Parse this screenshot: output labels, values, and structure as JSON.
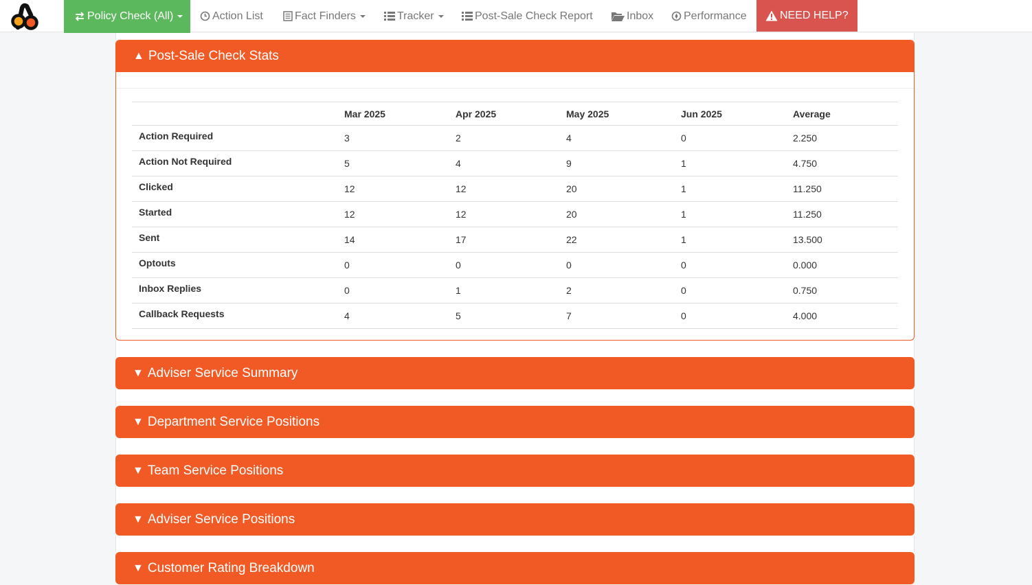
{
  "nav": {
    "items": [
      {
        "label": "Policy Check (All)",
        "icon": "exchange-arrows-icon",
        "dropdown": true
      },
      {
        "label": "Action List",
        "icon": "clock-icon",
        "dropdown": false
      },
      {
        "label": "Fact Finders",
        "icon": "document-list-icon",
        "dropdown": true
      },
      {
        "label": "Tracker",
        "icon": "list-icon",
        "dropdown": true
      },
      {
        "label": "Post-Sale Check Report",
        "icon": "list-icon",
        "dropdown": false
      },
      {
        "label": "Inbox",
        "icon": "folder-open-icon",
        "dropdown": false
      },
      {
        "label": "Performance",
        "icon": "dashboard-icon",
        "dropdown": false
      }
    ],
    "help_label": "NEED HELP?",
    "help_icon": "warning-triangle-icon"
  },
  "colors": {
    "accent": "#f15a24",
    "nav_active": "#5cb85c",
    "help": "#d9534f"
  },
  "stats_panel": {
    "title": "Post-Sale Check Stats",
    "expanded_icon": "▲",
    "columns": [
      "",
      "Mar 2025",
      "Apr 2025",
      "May 2025",
      "Jun 2025",
      "Average"
    ],
    "rows": [
      {
        "label": "Action Required",
        "values": [
          "3",
          "2",
          "4",
          "0",
          "2.250"
        ]
      },
      {
        "label": "Action Not Required",
        "values": [
          "5",
          "4",
          "9",
          "1",
          "4.750"
        ]
      },
      {
        "label": "Clicked",
        "values": [
          "12",
          "12",
          "20",
          "1",
          "11.250"
        ]
      },
      {
        "label": "Started",
        "values": [
          "12",
          "12",
          "20",
          "1",
          "11.250"
        ]
      },
      {
        "label": "Sent",
        "values": [
          "14",
          "17",
          "22",
          "1",
          "13.500"
        ]
      },
      {
        "label": "Optouts",
        "values": [
          "0",
          "0",
          "0",
          "0",
          "0.000"
        ]
      },
      {
        "label": "Inbox Replies",
        "values": [
          "0",
          "1",
          "2",
          "0",
          "0.750"
        ]
      },
      {
        "label": "Callback Requests",
        "values": [
          "4",
          "5",
          "7",
          "0",
          "4.000"
        ]
      }
    ]
  },
  "collapsed_panels": [
    {
      "title": "Adviser Service Summary",
      "icon": "▼"
    },
    {
      "title": "Department Service Positions",
      "icon": "▼"
    },
    {
      "title": "Team Service Positions",
      "icon": "▼"
    },
    {
      "title": "Adviser Service Positions",
      "icon": "▼"
    },
    {
      "title": "Customer Rating Breakdown",
      "icon": "▼"
    }
  ]
}
